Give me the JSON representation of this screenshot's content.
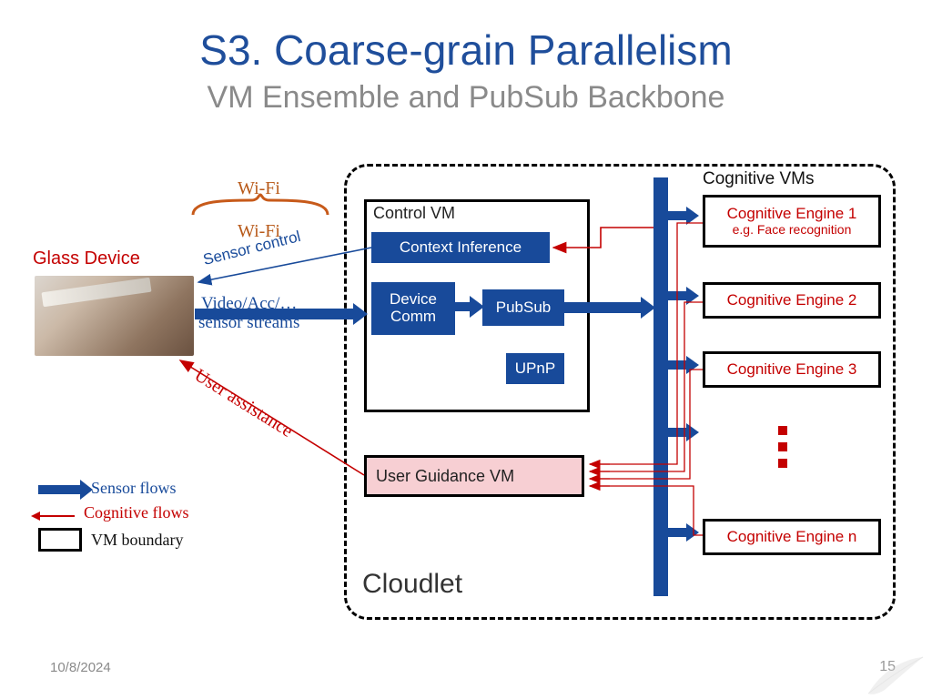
{
  "title": "S3. Coarse-grain Parallelism",
  "subtitle": "VM Ensemble and PubSub Backbone",
  "footer": {
    "date": "10/8/2024",
    "page": "15"
  },
  "glass": {
    "label": "Glass Device"
  },
  "labels": {
    "wifi": "Wi-Fi",
    "sensor_control": "Sensor control",
    "streams_l1": "Video/Acc/…",
    "streams_l2": "sensor streams",
    "user_assist": "User assistance",
    "cloudlet": "Cloudlet",
    "cogvms": "Cognitive VMs"
  },
  "control_vm": {
    "title": "Control VM",
    "context": "Context Inference",
    "devcomm": "Device\nComm",
    "pubsub": "PubSub",
    "upnp": "UPnP"
  },
  "ugvm": "User Guidance VM",
  "cognitive": {
    "e1": "Cognitive Engine 1",
    "e1_sub": "e.g. Face recognition",
    "e2": "Cognitive Engine 2",
    "e3": "Cognitive Engine 3",
    "en": "Cognitive Engine n"
  },
  "legend": {
    "sensor": "Sensor flows",
    "cognitive": "Cognitive flows",
    "vm": "VM boundary"
  }
}
